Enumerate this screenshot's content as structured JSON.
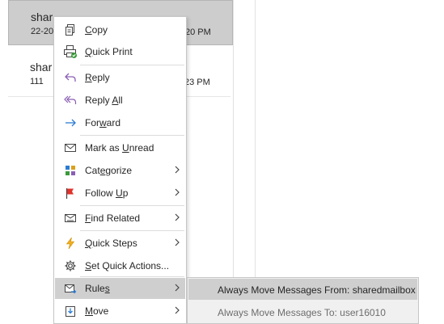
{
  "messages": [
    {
      "sender": "shar",
      "snippet": "22-20",
      "time": "20 PM"
    },
    {
      "sender": "shar",
      "snippet": "111",
      "time": "23 PM"
    }
  ],
  "menu": {
    "copy": {
      "pre": "",
      "key": "C",
      "post": "opy"
    },
    "quick_print": {
      "pre": "",
      "key": "Q",
      "post": "uick Print"
    },
    "reply": {
      "pre": "",
      "key": "R",
      "post": "eply"
    },
    "reply_all": {
      "pre": "Reply ",
      "key": "A",
      "post": "ll"
    },
    "forward": {
      "pre": "For",
      "key": "w",
      "post": "ard"
    },
    "mark_unread": {
      "pre": "Mark as ",
      "key": "U",
      "post": "nread"
    },
    "categorize": {
      "pre": "Cat",
      "key": "e",
      "post": "gorize"
    },
    "follow_up": {
      "pre": "Follow ",
      "key": "U",
      "post": "p"
    },
    "find_related": {
      "pre": "",
      "key": "F",
      "post": "ind Related"
    },
    "quick_steps": {
      "pre": "",
      "key": "Q",
      "post": "uick Steps"
    },
    "set_quick_actions": {
      "pre": "",
      "key": "S",
      "post": "et Quick Actions..."
    },
    "rules": {
      "pre": "Rule",
      "key": "s",
      "post": ""
    },
    "move": {
      "pre": "",
      "key": "M",
      "post": "ove"
    }
  },
  "submenu": {
    "move_from": "Always Move Messages From: sharedmailbox",
    "move_to": "Always Move Messages To: user16010"
  },
  "colors": {
    "accent_purple": "#8b5fb3",
    "accent_blue": "#2b7cd3",
    "highlight": "#cfcfcf"
  }
}
